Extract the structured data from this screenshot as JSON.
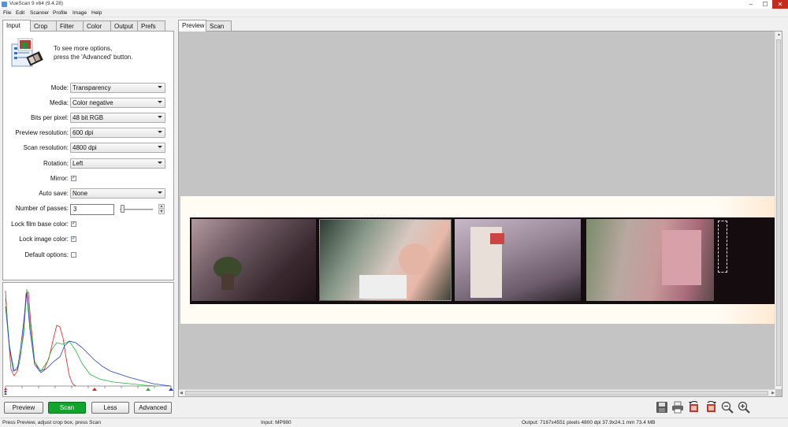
{
  "window": {
    "title": "VueScan 9 x64 (9.4.28)",
    "minimize": "–",
    "maximize": "☐",
    "close": "✕"
  },
  "menu": [
    "File",
    "Edit",
    "Scanner",
    "Profile",
    "Image",
    "Help"
  ],
  "left_tabs": [
    {
      "label": "Input",
      "active": true
    },
    {
      "label": "Crop",
      "active": false
    },
    {
      "label": "Filter",
      "active": false
    },
    {
      "label": "Color",
      "active": false
    },
    {
      "label": "Output",
      "active": false
    },
    {
      "label": "Prefs",
      "active": false
    }
  ],
  "right_tabs": [
    {
      "label": "Preview",
      "active": true
    },
    {
      "label": "Scan",
      "active": false
    }
  ],
  "info": {
    "line1": "To see more options,",
    "line2": "press the 'Advanced' button."
  },
  "settings": {
    "mode": {
      "label": "Mode:",
      "value": "Transparency"
    },
    "media": {
      "label": "Media:",
      "value": "Color negative"
    },
    "bits_per_pixel": {
      "label": "Bits per pixel:",
      "value": "48 bit RGB"
    },
    "preview_resolution": {
      "label": "Preview resolution:",
      "value": "600 dpi"
    },
    "scan_resolution": {
      "label": "Scan resolution:",
      "value": "4800 dpi"
    },
    "rotation": {
      "label": "Rotation:",
      "value": "Left"
    },
    "mirror": {
      "label": "Mirror:",
      "checked": true
    },
    "auto_save": {
      "label": "Auto save:",
      "value": "None"
    },
    "number_of_passes": {
      "label": "Number of passes:",
      "value": "3"
    },
    "lock_film_base_color": {
      "label": "Lock film base color:",
      "checked": true
    },
    "lock_image_color": {
      "label": "Lock image color:",
      "checked": true
    },
    "default_options": {
      "label": "Default options:",
      "checked": false
    }
  },
  "check_glyph": "✓",
  "buttons": {
    "preview": "Preview",
    "scan": "Scan",
    "less": "Less",
    "advanced": "Advanced"
  },
  "toolbar_icons": [
    "save-icon",
    "print-icon",
    "rotate-left-icon",
    "rotate-right-icon",
    "zoom-out-icon",
    "zoom-in-icon"
  ],
  "status": {
    "left": "Press Preview, adjust crop box, press Scan",
    "middle": "Input: MP980",
    "right": "Output: 7167x4551 pixels 4800 dpi 37.9x24.1 mm 73.4 MB"
  },
  "colors": {
    "scan_button": "#12a52e",
    "close_button": "#c42b1c",
    "preview_background": "#c4c4c4",
    "film_base": "#fffcf4"
  }
}
